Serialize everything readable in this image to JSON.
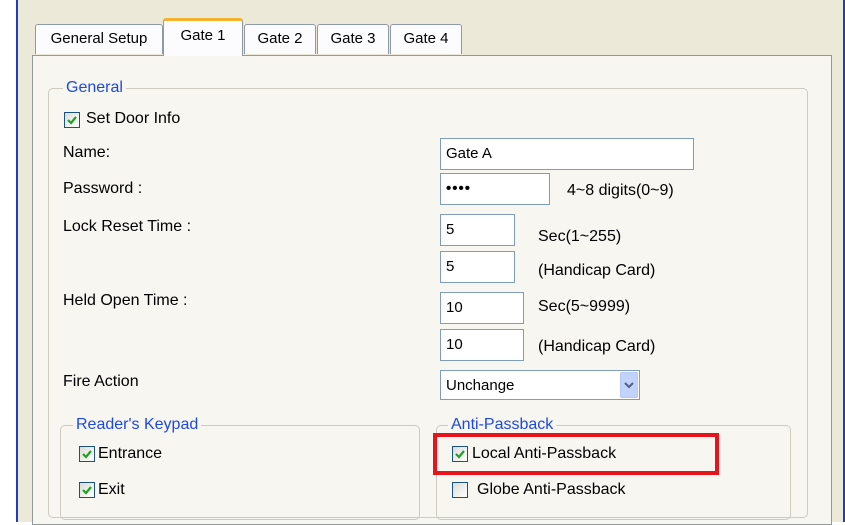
{
  "tabs": [
    "General Setup",
    "Gate 1",
    "Gate 2",
    "Gate 3",
    "Gate 4"
  ],
  "active_tab": "Gate 1",
  "general": {
    "legend": "General",
    "set_door_info": {
      "label": "Set Door Info",
      "checked": true
    },
    "name": {
      "label": "Name:",
      "value": "Gate A"
    },
    "password": {
      "label": "Password :",
      "value": "••••",
      "hint": "4~8 digits(0~9)"
    },
    "lock_reset": {
      "label": "Lock Reset Time :",
      "value": "5",
      "unit": "Sec(1~255)",
      "handicap_value": "5",
      "handicap_label": "(Handicap Card)"
    },
    "held_open": {
      "label": "Held Open Time :",
      "value": "10",
      "unit": "Sec(5~9999)",
      "handicap_value": "10",
      "handicap_label": "(Handicap Card)"
    },
    "fire_action": {
      "label": "Fire Action",
      "value": "Unchange"
    }
  },
  "readers_keypad": {
    "legend": "Reader's Keypad",
    "entrance": {
      "label": "Entrance",
      "checked": true
    },
    "exit": {
      "label": "Exit",
      "checked": true
    }
  },
  "anti_passback": {
    "legend": "Anti-Passback",
    "local": {
      "label": "Local Anti-Passback",
      "checked": true
    },
    "globe": {
      "label": "Globe Anti-Passback",
      "checked": false
    }
  },
  "colors": {
    "legend_blue": "#1e49e0",
    "highlight_red": "#e8141c",
    "active_tab_accent": "#f5b22c",
    "check_green": "#21a121"
  },
  "icons": {
    "check": "check-icon",
    "dropdown": "chevron-down-icon"
  }
}
